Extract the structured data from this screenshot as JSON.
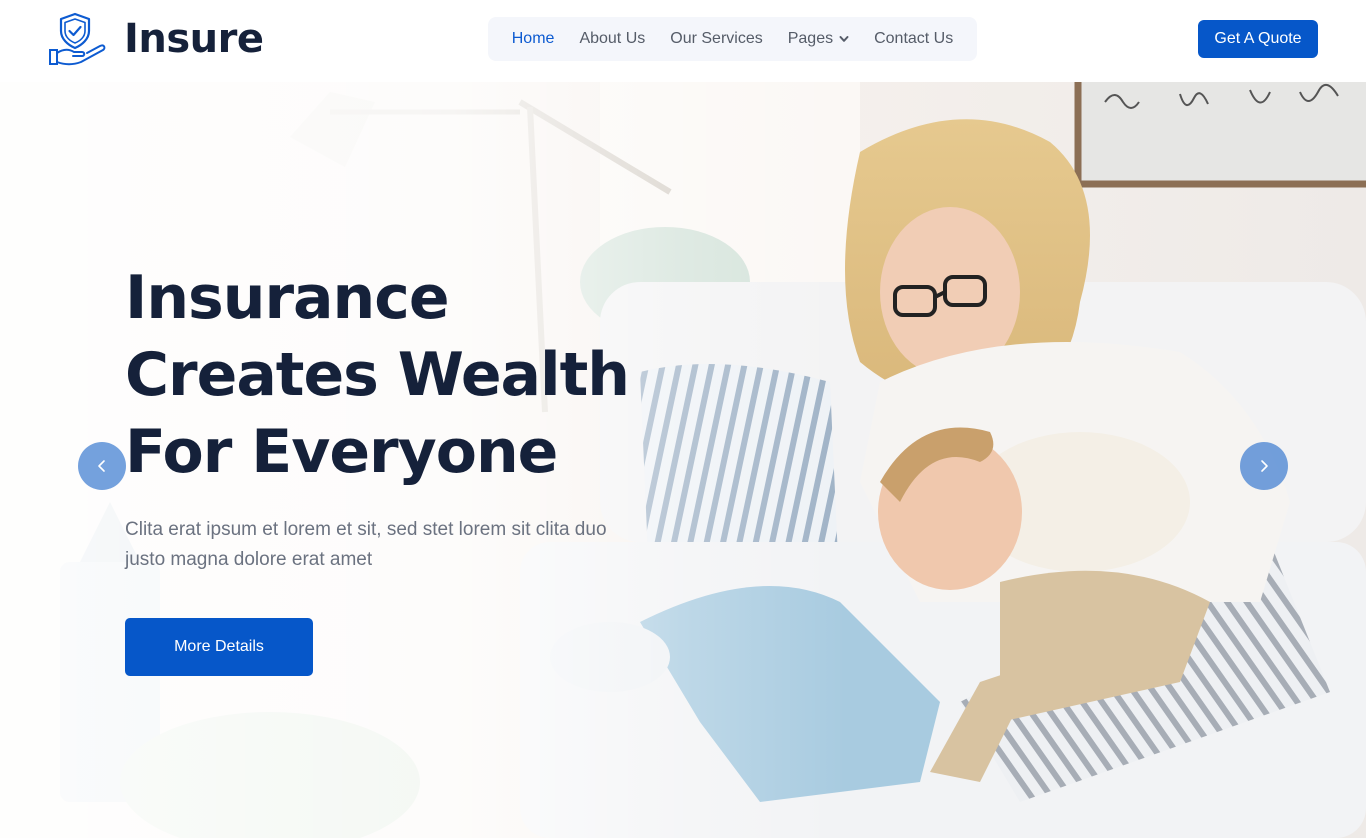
{
  "brand": {
    "name": "Insure",
    "icon": "shield-hand-icon"
  },
  "nav": {
    "items": [
      {
        "label": "Home",
        "active": true
      },
      {
        "label": "About Us"
      },
      {
        "label": "Our Services"
      },
      {
        "label": "Pages",
        "dropdown": true
      },
      {
        "label": "Contact Us"
      }
    ]
  },
  "header": {
    "cta_label": "Get A Quote"
  },
  "hero": {
    "title_lines": [
      "Insurance",
      "Creates Wealth",
      "For Everyone"
    ],
    "text": "Clita erat ipsum et lorem et sit, sed stet lorem sit clita duo justo magna dolore erat amet",
    "button_label": "More Details",
    "prev_icon": "chevron-left-icon",
    "next_icon": "chevron-right-icon",
    "image": "mother-and-child-on-sofa-photo"
  },
  "colors": {
    "primary": "#0657c9",
    "heading": "#15213a",
    "nav_active": "#0d5bd1",
    "nav_text": "#555c68",
    "body_text": "#6b7280",
    "nav_bg": "#f4f6fb"
  }
}
